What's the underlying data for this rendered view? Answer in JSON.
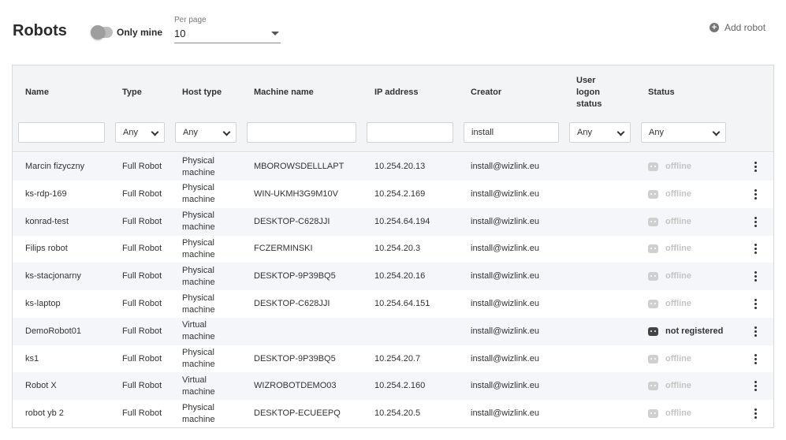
{
  "header": {
    "title": "Robots",
    "only_mine_label": "Only mine",
    "per_page_label": "Per page",
    "per_page_value": "10",
    "add_robot_label": "Add robot"
  },
  "table": {
    "columns": [
      "Name",
      "Type",
      "Host type",
      "Machine name",
      "IP address",
      "Creator",
      "User logon status",
      "Status"
    ],
    "filters": {
      "name": "",
      "type": "Any",
      "host_type": "Any",
      "machine_name": "",
      "ip_address": "",
      "creator": "install",
      "user_logon_status": "Any",
      "status": "Any"
    },
    "rows": [
      {
        "name": "Marcin fizyczny",
        "type": "Full Robot",
        "host": "Physical machine",
        "machine": "MBOROWSDELLLAPT",
        "ip": "10.254.20.13",
        "creator": "install@wizlink.eu",
        "logon": "",
        "status": "offline"
      },
      {
        "name": "ks-rdp-169",
        "type": "Full Robot",
        "host": "Physical machine",
        "machine": "WIN-UKMH3G9M10V",
        "ip": "10.254.2.169",
        "creator": "install@wizlink.eu",
        "logon": "",
        "status": "offline"
      },
      {
        "name": "konrad-test",
        "type": "Full Robot",
        "host": "Physical machine",
        "machine": "DESKTOP-C628JJI",
        "ip": "10.254.64.194",
        "creator": "install@wizlink.eu",
        "logon": "",
        "status": "offline"
      },
      {
        "name": "Filips robot",
        "type": "Full Robot",
        "host": "Physical machine",
        "machine": "FCZERMINSKI",
        "ip": "10.254.20.3",
        "creator": "install@wizlink.eu",
        "logon": "",
        "status": "offline"
      },
      {
        "name": "ks-stacjonarny",
        "type": "Full Robot",
        "host": "Physical machine",
        "machine": "DESKTOP-9P39BQ5",
        "ip": "10.254.20.16",
        "creator": "install@wizlink.eu",
        "logon": "",
        "status": "offline"
      },
      {
        "name": "ks-laptop",
        "type": "Full Robot",
        "host": "Physical machine",
        "machine": "DESKTOP-C628JJI",
        "ip": "10.254.64.151",
        "creator": "install@wizlink.eu",
        "logon": "",
        "status": "offline"
      },
      {
        "name": "DemoRobot01",
        "type": "Full Robot",
        "host": "Virtual machine",
        "machine": "",
        "ip": "",
        "creator": "install@wizlink.eu",
        "logon": "",
        "status": "not registered"
      },
      {
        "name": "ks1",
        "type": "Full Robot",
        "host": "Physical machine",
        "machine": "DESKTOP-9P39BQ5",
        "ip": "10.254.20.7",
        "creator": "install@wizlink.eu",
        "logon": "",
        "status": "offline"
      },
      {
        "name": "Robot X",
        "type": "Full Robot",
        "host": "Virtual machine",
        "machine": "WIZROBOTDEMO03",
        "ip": "10.254.2.160",
        "creator": "install@wizlink.eu",
        "logon": "",
        "status": "offline"
      },
      {
        "name": "robot yb 2",
        "type": "Full Robot",
        "host": "Physical machine",
        "machine": "DESKTOP-ECUEEPQ",
        "ip": "10.254.20.5",
        "creator": "install@wizlink.eu",
        "logon": "",
        "status": "offline"
      }
    ]
  },
  "colors": {
    "header_bg": "#f3f4f6",
    "row_stripe": "#f5f6fa",
    "status_offline": "#c4c4c4",
    "status_not_registered": "#333333"
  }
}
